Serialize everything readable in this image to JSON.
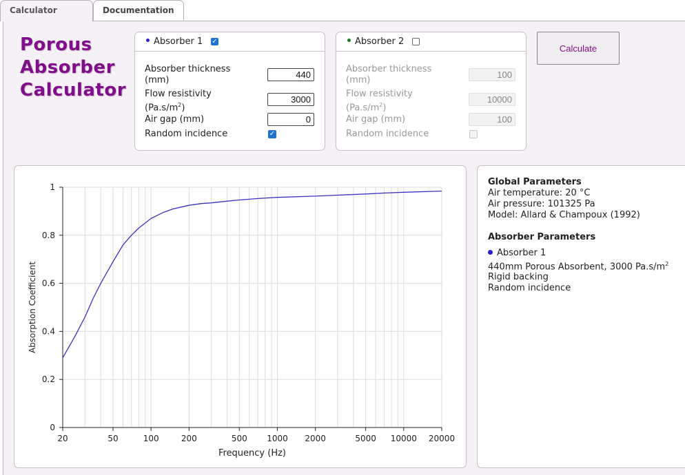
{
  "tabs": [
    {
      "label": "Calculator",
      "active": true
    },
    {
      "label": "Documentation",
      "active": false
    }
  ],
  "app": {
    "title_lines": [
      "Porous",
      "Absorber",
      "Calculator"
    ]
  },
  "absorber1": {
    "title": "Absorber 1",
    "enabled": true,
    "dot_color": "#2a1ecf",
    "thickness_label_1": "Absorber thickness",
    "thickness_label_2": "(mm)",
    "thickness": "440",
    "flow_label_1": "Flow resistivity",
    "flow_label_2": "(Pa.s/m",
    "flow_sup": "2",
    "flow_label_3": ")",
    "flow": "3000",
    "airgap_label": "Air gap (mm)",
    "airgap": "0",
    "random_label": "Random incidence",
    "random": true
  },
  "absorber2": {
    "title": "Absorber 2",
    "enabled": false,
    "dot_color": "#1a7a2a",
    "thickness_label_1": "Absorber thickness",
    "thickness_label_2": "(mm)",
    "thickness": "100",
    "flow_label_1": "Flow resistivity",
    "flow_label_2": "(Pa.s/m",
    "flow_sup": "2",
    "flow_label_3": ")",
    "flow": "10000",
    "airgap_label": "Air gap (mm)",
    "airgap": "100",
    "random_label": "Random incidence",
    "random": false
  },
  "calculate_label": "Calculate",
  "info": {
    "global_heading": "Global Parameters",
    "air_temp": "Air temperature: 20 °C",
    "air_pressure": "Air pressure: 101325 Pa",
    "model": "Model: Allard & Champoux (1992)",
    "absorber_heading": "Absorber Parameters",
    "absorber_name": "Absorber 1",
    "absorber_desc": "440mm Porous Absorbent, 3000 Pa.s/m",
    "absorber_desc_sup": "2",
    "backing": "Rigid backing",
    "incidence": "Random incidence"
  },
  "chart_data": {
    "type": "line",
    "xlabel": "Frequency (Hz)",
    "ylabel": "Absorption Coefficient",
    "xscale": "log",
    "xlim": [
      20,
      20000
    ],
    "ylim": [
      0,
      1
    ],
    "xticks": [
      20,
      50,
      100,
      200,
      500,
      1000,
      2000,
      5000,
      10000,
      20000
    ],
    "yticks": [
      0,
      0.2,
      0.4,
      0.6,
      0.8,
      1
    ],
    "grid": true,
    "series": [
      {
        "color": "#3a2fc2",
        "x": [
          20,
          25,
          30,
          35,
          40,
          50,
          60,
          70,
          80,
          100,
          125,
          150,
          200,
          250,
          300,
          400,
          500,
          700,
          1000,
          2000,
          3000,
          5000,
          7000,
          10000,
          20000
        ],
        "y": [
          0.29,
          0.38,
          0.46,
          0.54,
          0.6,
          0.69,
          0.76,
          0.8,
          0.83,
          0.87,
          0.895,
          0.91,
          0.925,
          0.932,
          0.935,
          0.942,
          0.947,
          0.953,
          0.958,
          0.963,
          0.967,
          0.972,
          0.976,
          0.979,
          0.984
        ]
      }
    ]
  }
}
